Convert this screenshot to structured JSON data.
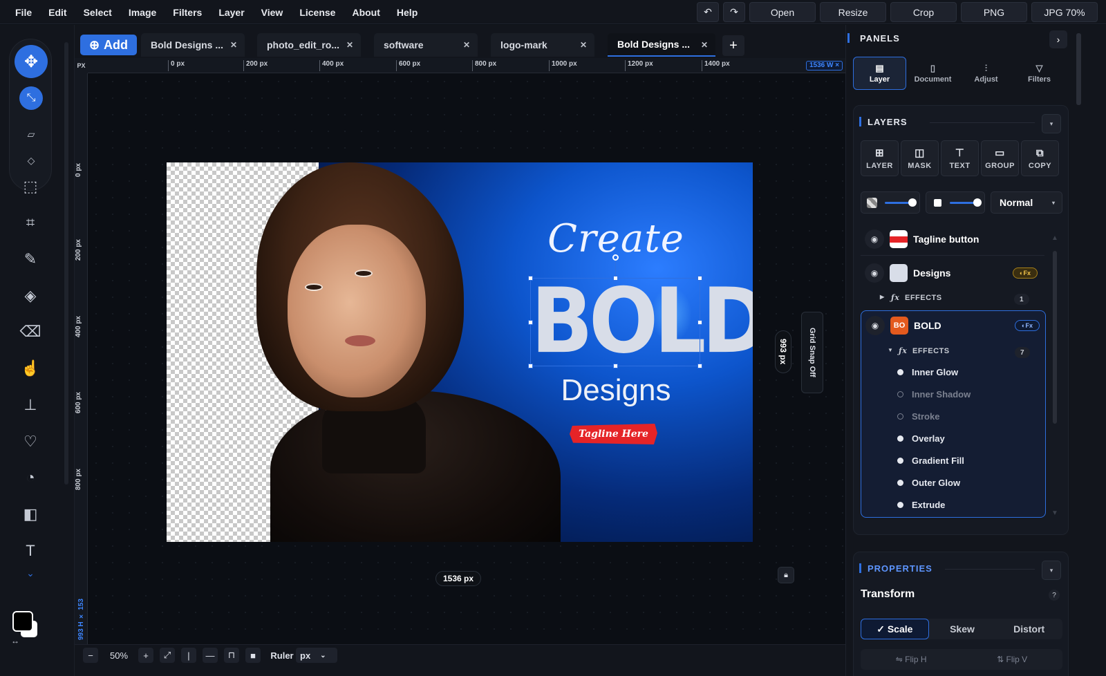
{
  "menu": [
    "File",
    "Edit",
    "Select",
    "Image",
    "Filters",
    "Layer",
    "View",
    "License",
    "About",
    "Help"
  ],
  "toolbar": {
    "undo_icon": "undo-icon",
    "redo_icon": "redo-icon",
    "open": "Open",
    "resize": "Resize",
    "crop": "Crop",
    "png": "PNG",
    "jpg": "JPG 70%"
  },
  "tabs": {
    "add_label": "Add",
    "items": [
      "Bold Designs ...",
      "photo_edit_ro...",
      "software",
      "logo-mark",
      "Bold Designs ..."
    ]
  },
  "ruler": {
    "corner": "PX",
    "h_marks": [
      "0 px",
      "200 px",
      "400 px",
      "600 px",
      "800 px",
      "1000 px",
      "1200 px",
      "1400 px"
    ],
    "h_badge": "1536 W ×",
    "v_marks": [
      "0 px",
      "200 px",
      "400 px",
      "600 px",
      "800 px"
    ],
    "v_badge": "993 H × 153"
  },
  "canvas": {
    "create": "Create",
    "bold": "BOLD",
    "designs": "Designs",
    "tagline": "Tagline Here",
    "width_badge": "1536 px",
    "height_badge": "993 px",
    "grid_snap": "Grid Snap Off"
  },
  "bottom": {
    "zoom": "50%",
    "ruler_label": "Ruler",
    "unit": "px"
  },
  "panels": {
    "title": "PANELS",
    "tabs": [
      {
        "label": "Layer",
        "icon": "layer-icon"
      },
      {
        "label": "Document",
        "icon": "document-icon"
      },
      {
        "label": "Adjust",
        "icon": "sliders-icon"
      },
      {
        "label": "Filters",
        "icon": "funnel-icon"
      }
    ],
    "layers": {
      "title": "LAYERS",
      "buttons": [
        "LAYER",
        "MASK",
        "TEXT",
        "GROUP",
        "COPY"
      ],
      "blend_mode": "Normal",
      "opacity": 0.9,
      "fill": 0.9
    },
    "items": [
      {
        "name": "Tagline button"
      },
      {
        "name": "Designs",
        "fx": "◐Fx",
        "effects_label": "EFFECTS",
        "effects_count": "1"
      },
      {
        "name": "BOLD",
        "fx": "◐Fx",
        "effects_label": "EFFECTS",
        "effects_count": "7",
        "effects": [
          {
            "name": "Inner Glow",
            "on": true
          },
          {
            "name": "Inner Shadow",
            "on": false
          },
          {
            "name": "Stroke",
            "on": false
          },
          {
            "name": "Overlay",
            "on": true
          },
          {
            "name": "Gradient Fill",
            "on": true
          },
          {
            "name": "Outer Glow",
            "on": true
          },
          {
            "name": "Extrude",
            "on": true
          }
        ]
      }
    ],
    "properties": {
      "title": "PROPERTIES",
      "transform": "Transform",
      "help": "?",
      "modes": [
        "✓ Scale",
        "Skew",
        "Distort"
      ],
      "flip_h": "⇋ Flip H",
      "flip_v": "⇅ Flip V"
    }
  },
  "colors": {
    "accent": "#2e6fe0",
    "tagline_red": "#e52427",
    "bg": "#0d1017"
  }
}
